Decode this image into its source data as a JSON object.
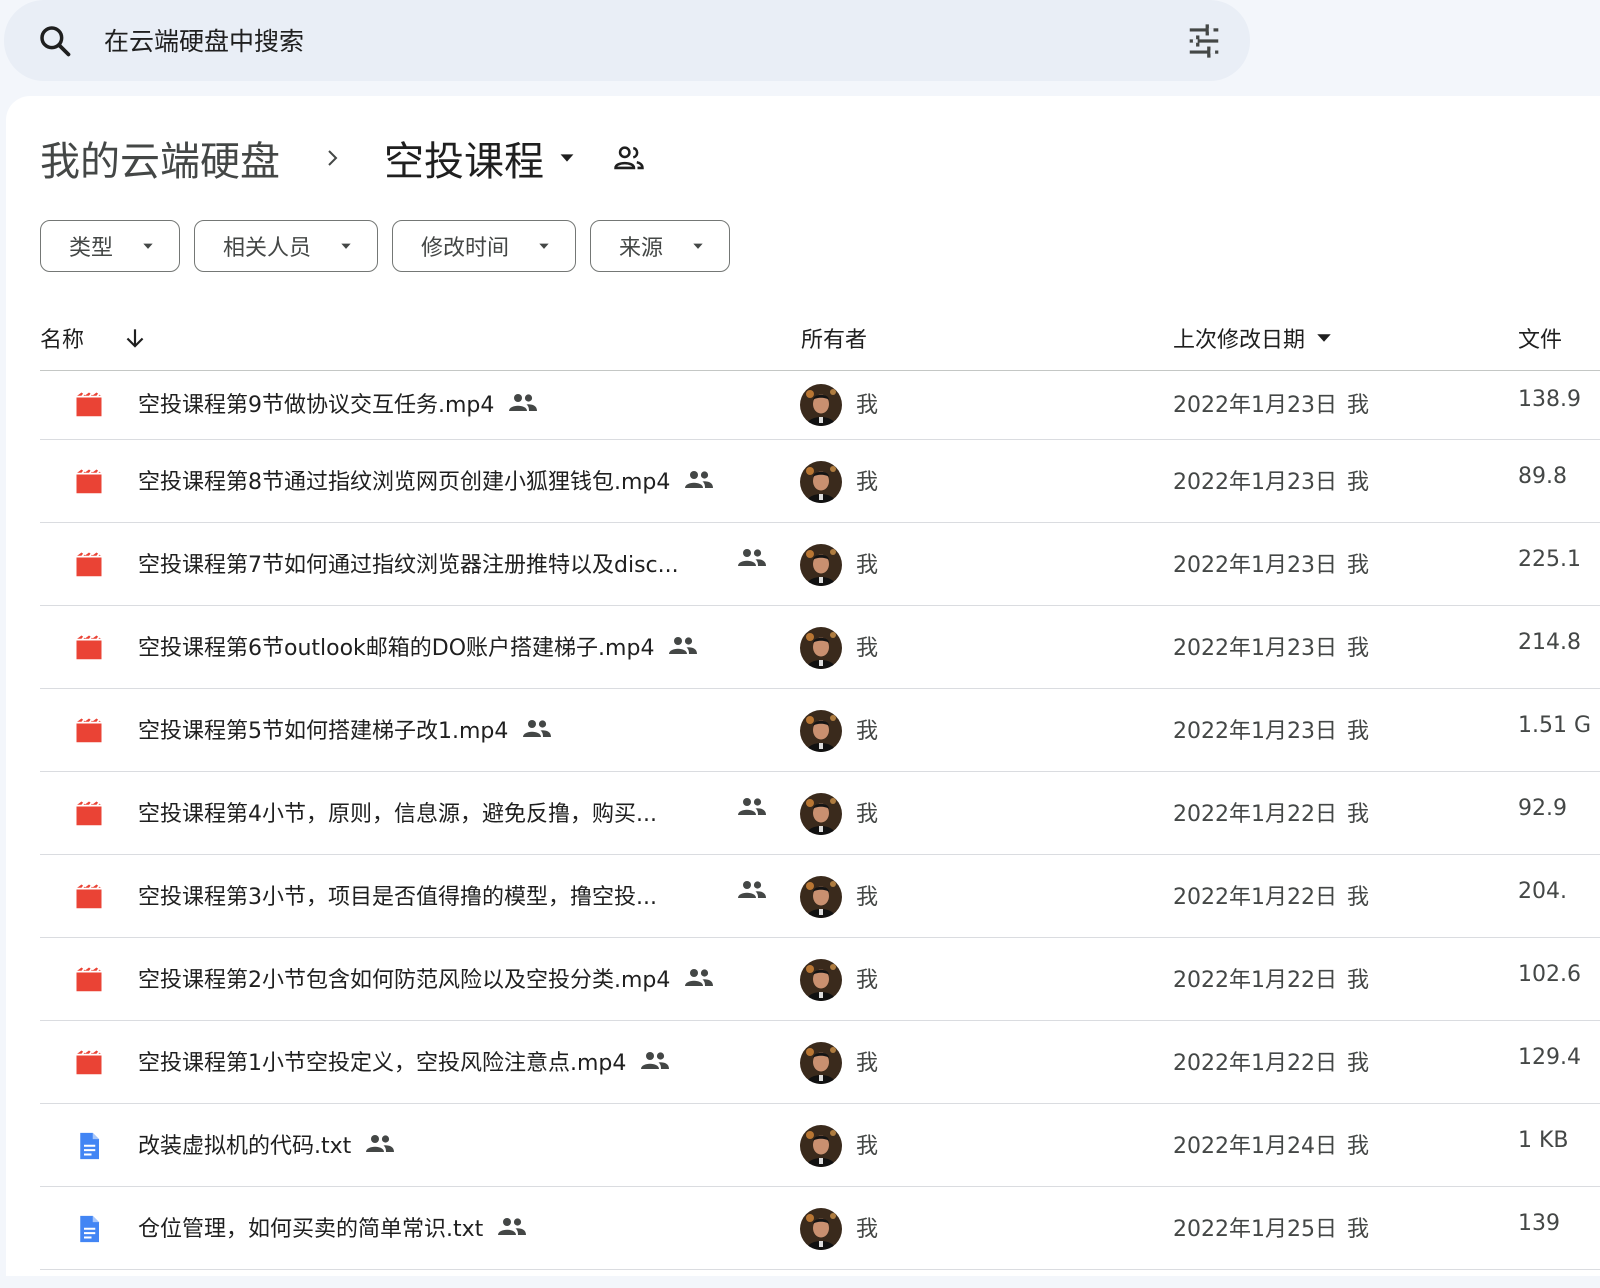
{
  "search": {
    "placeholder": "在云端硬盘中搜索"
  },
  "breadcrumb": {
    "root": "我的云端硬盘",
    "current": "空投课程"
  },
  "chips": [
    {
      "label": "类型"
    },
    {
      "label": "相关人员"
    },
    {
      "label": "修改时间"
    },
    {
      "label": "来源"
    }
  ],
  "columns": {
    "name": "名称",
    "owner": "所有者",
    "modified": "上次修改日期",
    "size": "文件"
  },
  "files": [
    {
      "name": "空投课程第9节做协议交互任务.mp4",
      "type": "video",
      "owner": "我",
      "modified": "2022年1月23日",
      "modified_by": "我",
      "size": "138.9"
    },
    {
      "name": "空投课程第8节通过指纹浏览网页创建小狐狸钱包.mp4",
      "type": "video",
      "owner": "我",
      "modified": "2022年1月23日",
      "modified_by": "我",
      "size": "89.8"
    },
    {
      "name": "空投课程第7节如何通过指纹浏览器注册推特以及disc...",
      "type": "video",
      "owner": "我",
      "modified": "2022年1月23日",
      "modified_by": "我",
      "size": "225.1"
    },
    {
      "name": "空投课程第6节outlook邮箱的DO账户搭建梯子.mp4",
      "type": "video",
      "owner": "我",
      "modified": "2022年1月23日",
      "modified_by": "我",
      "size": "214.8"
    },
    {
      "name": "空投课程第5节如何搭建梯子改1.mp4",
      "type": "video",
      "owner": "我",
      "modified": "2022年1月23日",
      "modified_by": "我",
      "size": "1.51 G"
    },
    {
      "name": "空投课程第4小节，原则，信息源，避免反撸，购买...",
      "type": "video",
      "owner": "我",
      "modified": "2022年1月22日",
      "modified_by": "我",
      "size": "92.9"
    },
    {
      "name": "空投课程第3小节，项目是否值得撸的模型，撸空投...",
      "type": "video",
      "owner": "我",
      "modified": "2022年1月22日",
      "modified_by": "我",
      "size": "204."
    },
    {
      "name": "空投课程第2小节包含如何防范风险以及空投分类.mp4",
      "type": "video",
      "owner": "我",
      "modified": "2022年1月22日",
      "modified_by": "我",
      "size": "102.6"
    },
    {
      "name": "空投课程第1小节空投定义，空投风险注意点.mp4",
      "type": "video",
      "owner": "我",
      "modified": "2022年1月22日",
      "modified_by": "我",
      "size": "129.4"
    },
    {
      "name": "改装虚拟机的代码.txt",
      "type": "doc",
      "owner": "我",
      "modified": "2022年1月24日",
      "modified_by": "我",
      "size": "1 KB"
    },
    {
      "name": "仓位管理，如何买卖的简单常识.txt",
      "type": "doc",
      "owner": "我",
      "modified": "2022年1月25日",
      "modified_by": "我",
      "size": "139"
    }
  ],
  "colors": {
    "video_icon": "#ea4335",
    "doc_icon": "#4285f4",
    "search_bg": "#e9eef6",
    "page_bg": "#f3f6fb"
  }
}
